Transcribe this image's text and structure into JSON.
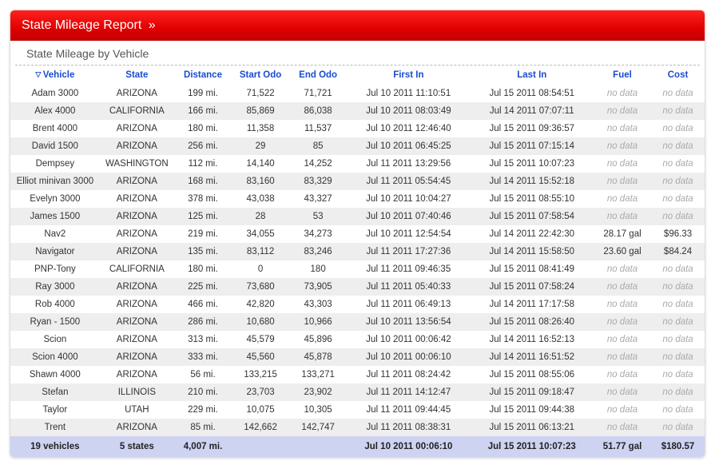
{
  "header": {
    "title": "State Mileage Report",
    "chevrons": "»"
  },
  "subheader": "State Mileage by Vehicle",
  "columns": {
    "vehicle": "Vehicle",
    "state": "State",
    "distance": "Distance",
    "start_odo": "Start Odo",
    "end_odo": "End Odo",
    "first_in": "First In",
    "last_in": "Last In",
    "fuel": "Fuel",
    "cost": "Cost"
  },
  "no_data_label": "no data",
  "rows": [
    {
      "vehicle": "Adam 3000",
      "state": "ARIZONA",
      "distance": "199 mi.",
      "start_odo": "71,522",
      "end_odo": "71,721",
      "first_in": "Jul 10 2011 11:10:51",
      "last_in": "Jul 15 2011 08:54:51",
      "fuel": null,
      "cost": null
    },
    {
      "vehicle": "Alex 4000",
      "state": "CALIFORNIA",
      "distance": "166 mi.",
      "start_odo": "85,869",
      "end_odo": "86,038",
      "first_in": "Jul 10 2011 08:03:49",
      "last_in": "Jul 14 2011 07:07:11",
      "fuel": null,
      "cost": null
    },
    {
      "vehicle": "Brent 4000",
      "state": "ARIZONA",
      "distance": "180 mi.",
      "start_odo": "11,358",
      "end_odo": "11,537",
      "first_in": "Jul 10 2011 12:46:40",
      "last_in": "Jul 15 2011 09:36:57",
      "fuel": null,
      "cost": null
    },
    {
      "vehicle": "David 1500",
      "state": "ARIZONA",
      "distance": "256 mi.",
      "start_odo": "29",
      "end_odo": "85",
      "first_in": "Jul 10 2011 06:45:25",
      "last_in": "Jul 15 2011 07:15:14",
      "fuel": null,
      "cost": null
    },
    {
      "vehicle": "Dempsey",
      "state": "WASHINGTON",
      "distance": "112 mi.",
      "start_odo": "14,140",
      "end_odo": "14,252",
      "first_in": "Jul 11 2011 13:29:56",
      "last_in": "Jul 15 2011 10:07:23",
      "fuel": null,
      "cost": null
    },
    {
      "vehicle": "Elliot minivan 3000",
      "state": "ARIZONA",
      "distance": "168 mi.",
      "start_odo": "83,160",
      "end_odo": "83,329",
      "first_in": "Jul 11 2011 05:54:45",
      "last_in": "Jul 14 2011 15:52:18",
      "fuel": null,
      "cost": null
    },
    {
      "vehicle": "Evelyn 3000",
      "state": "ARIZONA",
      "distance": "378 mi.",
      "start_odo": "43,038",
      "end_odo": "43,327",
      "first_in": "Jul 10 2011 10:04:27",
      "last_in": "Jul 15 2011 08:55:10",
      "fuel": null,
      "cost": null
    },
    {
      "vehicle": "James 1500",
      "state": "ARIZONA",
      "distance": "125 mi.",
      "start_odo": "28",
      "end_odo": "53",
      "first_in": "Jul 10 2011 07:40:46",
      "last_in": "Jul 15 2011 07:58:54",
      "fuel": null,
      "cost": null
    },
    {
      "vehicle": "Nav2",
      "state": "ARIZONA",
      "distance": "219 mi.",
      "start_odo": "34,055",
      "end_odo": "34,273",
      "first_in": "Jul 10 2011 12:54:54",
      "last_in": "Jul 14 2011 22:42:30",
      "fuel": "28.17 gal",
      "cost": "$96.33"
    },
    {
      "vehicle": "Navigator",
      "state": "ARIZONA",
      "distance": "135 mi.",
      "start_odo": "83,112",
      "end_odo": "83,246",
      "first_in": "Jul 11 2011 17:27:36",
      "last_in": "Jul 14 2011 15:58:50",
      "fuel": "23.60 gal",
      "cost": "$84.24"
    },
    {
      "vehicle": "PNP-Tony",
      "state": "CALIFORNIA",
      "distance": "180 mi.",
      "start_odo": "0",
      "end_odo": "180",
      "first_in": "Jul 11 2011 09:46:35",
      "last_in": "Jul 15 2011 08:41:49",
      "fuel": null,
      "cost": null
    },
    {
      "vehicle": "Ray 3000",
      "state": "ARIZONA",
      "distance": "225 mi.",
      "start_odo": "73,680",
      "end_odo": "73,905",
      "first_in": "Jul 11 2011 05:40:33",
      "last_in": "Jul 15 2011 07:58:24",
      "fuel": null,
      "cost": null
    },
    {
      "vehicle": "Rob 4000",
      "state": "ARIZONA",
      "distance": "466 mi.",
      "start_odo": "42,820",
      "end_odo": "43,303",
      "first_in": "Jul 11 2011 06:49:13",
      "last_in": "Jul 14 2011 17:17:58",
      "fuel": null,
      "cost": null
    },
    {
      "vehicle": "Ryan - 1500",
      "state": "ARIZONA",
      "distance": "286 mi.",
      "start_odo": "10,680",
      "end_odo": "10,966",
      "first_in": "Jul 10 2011 13:56:54",
      "last_in": "Jul 15 2011 08:26:40",
      "fuel": null,
      "cost": null
    },
    {
      "vehicle": "Scion",
      "state": "ARIZONA",
      "distance": "313 mi.",
      "start_odo": "45,579",
      "end_odo": "45,896",
      "first_in": "Jul 10 2011 00:06:42",
      "last_in": "Jul 14 2011 16:52:13",
      "fuel": null,
      "cost": null
    },
    {
      "vehicle": "Scion 4000",
      "state": "ARIZONA",
      "distance": "333 mi.",
      "start_odo": "45,560",
      "end_odo": "45,878",
      "first_in": "Jul 10 2011 00:06:10",
      "last_in": "Jul 14 2011 16:51:52",
      "fuel": null,
      "cost": null
    },
    {
      "vehicle": "Shawn 4000",
      "state": "ARIZONA",
      "distance": "56 mi.",
      "start_odo": "133,215",
      "end_odo": "133,271",
      "first_in": "Jul 11 2011 08:24:42",
      "last_in": "Jul 15 2011 08:55:06",
      "fuel": null,
      "cost": null
    },
    {
      "vehicle": "Stefan",
      "state": "ILLINOIS",
      "distance": "210 mi.",
      "start_odo": "23,703",
      "end_odo": "23,902",
      "first_in": "Jul 11 2011 14:12:47",
      "last_in": "Jul 15 2011 09:18:47",
      "fuel": null,
      "cost": null
    },
    {
      "vehicle": "Taylor",
      "state": "UTAH",
      "distance": "229 mi.",
      "start_odo": "10,075",
      "end_odo": "10,305",
      "first_in": "Jul 11 2011 09:44:45",
      "last_in": "Jul 15 2011 09:44:38",
      "fuel": null,
      "cost": null
    },
    {
      "vehicle": "Trent",
      "state": "ARIZONA",
      "distance": "85 mi.",
      "start_odo": "142,662",
      "end_odo": "142,747",
      "first_in": "Jul 11 2011 08:38:31",
      "last_in": "Jul 15 2011 06:13:21",
      "fuel": null,
      "cost": null
    }
  ],
  "totals": {
    "vehicle": "19 vehicles",
    "state": "5 states",
    "distance": "4,007 mi.",
    "start_odo": "",
    "end_odo": "",
    "first_in": "Jul 10 2011 00:06:10",
    "last_in": "Jul 15 2011 10:07:23",
    "fuel": "51.77 gal",
    "cost": "$180.57"
  }
}
